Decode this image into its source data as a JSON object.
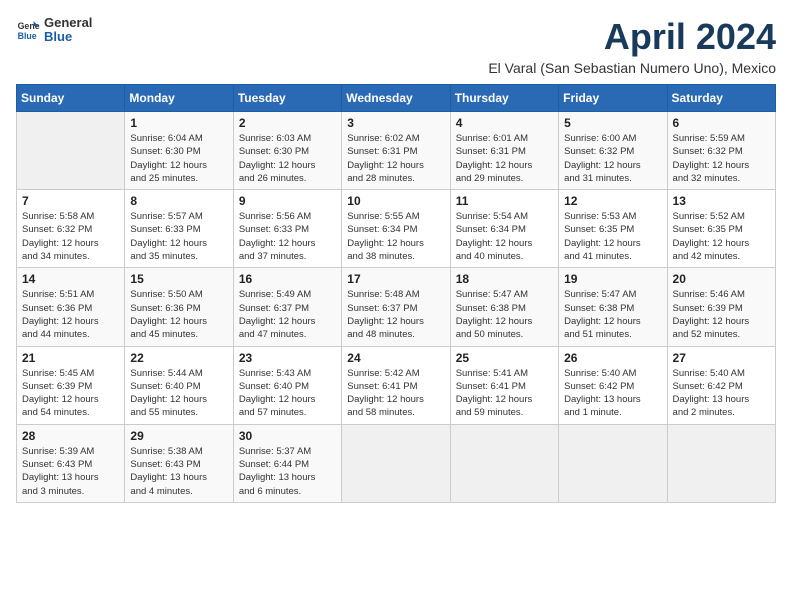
{
  "logo": {
    "general": "General",
    "blue": "Blue"
  },
  "title": "April 2024",
  "location": "El Varal (San Sebastian Numero Uno), Mexico",
  "days_header": [
    "Sunday",
    "Monday",
    "Tuesday",
    "Wednesday",
    "Thursday",
    "Friday",
    "Saturday"
  ],
  "weeks": [
    [
      {
        "day": "",
        "info": ""
      },
      {
        "day": "1",
        "info": "Sunrise: 6:04 AM\nSunset: 6:30 PM\nDaylight: 12 hours\nand 25 minutes."
      },
      {
        "day": "2",
        "info": "Sunrise: 6:03 AM\nSunset: 6:30 PM\nDaylight: 12 hours\nand 26 minutes."
      },
      {
        "day": "3",
        "info": "Sunrise: 6:02 AM\nSunset: 6:31 PM\nDaylight: 12 hours\nand 28 minutes."
      },
      {
        "day": "4",
        "info": "Sunrise: 6:01 AM\nSunset: 6:31 PM\nDaylight: 12 hours\nand 29 minutes."
      },
      {
        "day": "5",
        "info": "Sunrise: 6:00 AM\nSunset: 6:32 PM\nDaylight: 12 hours\nand 31 minutes."
      },
      {
        "day": "6",
        "info": "Sunrise: 5:59 AM\nSunset: 6:32 PM\nDaylight: 12 hours\nand 32 minutes."
      }
    ],
    [
      {
        "day": "7",
        "info": "Sunrise: 5:58 AM\nSunset: 6:32 PM\nDaylight: 12 hours\nand 34 minutes."
      },
      {
        "day": "8",
        "info": "Sunrise: 5:57 AM\nSunset: 6:33 PM\nDaylight: 12 hours\nand 35 minutes."
      },
      {
        "day": "9",
        "info": "Sunrise: 5:56 AM\nSunset: 6:33 PM\nDaylight: 12 hours\nand 37 minutes."
      },
      {
        "day": "10",
        "info": "Sunrise: 5:55 AM\nSunset: 6:34 PM\nDaylight: 12 hours\nand 38 minutes."
      },
      {
        "day": "11",
        "info": "Sunrise: 5:54 AM\nSunset: 6:34 PM\nDaylight: 12 hours\nand 40 minutes."
      },
      {
        "day": "12",
        "info": "Sunrise: 5:53 AM\nSunset: 6:35 PM\nDaylight: 12 hours\nand 41 minutes."
      },
      {
        "day": "13",
        "info": "Sunrise: 5:52 AM\nSunset: 6:35 PM\nDaylight: 12 hours\nand 42 minutes."
      }
    ],
    [
      {
        "day": "14",
        "info": "Sunrise: 5:51 AM\nSunset: 6:36 PM\nDaylight: 12 hours\nand 44 minutes."
      },
      {
        "day": "15",
        "info": "Sunrise: 5:50 AM\nSunset: 6:36 PM\nDaylight: 12 hours\nand 45 minutes."
      },
      {
        "day": "16",
        "info": "Sunrise: 5:49 AM\nSunset: 6:37 PM\nDaylight: 12 hours\nand 47 minutes."
      },
      {
        "day": "17",
        "info": "Sunrise: 5:48 AM\nSunset: 6:37 PM\nDaylight: 12 hours\nand 48 minutes."
      },
      {
        "day": "18",
        "info": "Sunrise: 5:47 AM\nSunset: 6:38 PM\nDaylight: 12 hours\nand 50 minutes."
      },
      {
        "day": "19",
        "info": "Sunrise: 5:47 AM\nSunset: 6:38 PM\nDaylight: 12 hours\nand 51 minutes."
      },
      {
        "day": "20",
        "info": "Sunrise: 5:46 AM\nSunset: 6:39 PM\nDaylight: 12 hours\nand 52 minutes."
      }
    ],
    [
      {
        "day": "21",
        "info": "Sunrise: 5:45 AM\nSunset: 6:39 PM\nDaylight: 12 hours\nand 54 minutes."
      },
      {
        "day": "22",
        "info": "Sunrise: 5:44 AM\nSunset: 6:40 PM\nDaylight: 12 hours\nand 55 minutes."
      },
      {
        "day": "23",
        "info": "Sunrise: 5:43 AM\nSunset: 6:40 PM\nDaylight: 12 hours\nand 57 minutes."
      },
      {
        "day": "24",
        "info": "Sunrise: 5:42 AM\nSunset: 6:41 PM\nDaylight: 12 hours\nand 58 minutes."
      },
      {
        "day": "25",
        "info": "Sunrise: 5:41 AM\nSunset: 6:41 PM\nDaylight: 12 hours\nand 59 minutes."
      },
      {
        "day": "26",
        "info": "Sunrise: 5:40 AM\nSunset: 6:42 PM\nDaylight: 13 hours\nand 1 minute."
      },
      {
        "day": "27",
        "info": "Sunrise: 5:40 AM\nSunset: 6:42 PM\nDaylight: 13 hours\nand 2 minutes."
      }
    ],
    [
      {
        "day": "28",
        "info": "Sunrise: 5:39 AM\nSunset: 6:43 PM\nDaylight: 13 hours\nand 3 minutes."
      },
      {
        "day": "29",
        "info": "Sunrise: 5:38 AM\nSunset: 6:43 PM\nDaylight: 13 hours\nand 4 minutes."
      },
      {
        "day": "30",
        "info": "Sunrise: 5:37 AM\nSunset: 6:44 PM\nDaylight: 13 hours\nand 6 minutes."
      },
      {
        "day": "",
        "info": ""
      },
      {
        "day": "",
        "info": ""
      },
      {
        "day": "",
        "info": ""
      },
      {
        "day": "",
        "info": ""
      }
    ]
  ]
}
